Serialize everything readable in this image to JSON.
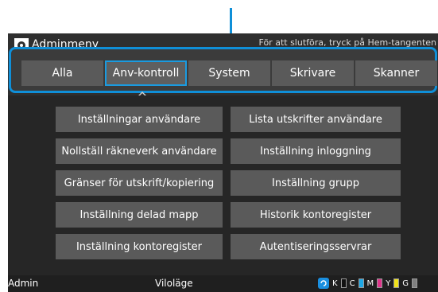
{
  "window": {
    "title": "Adminmeny",
    "hint": "För att slutföra, tryck på Hem-tangenten"
  },
  "tabs": [
    {
      "label": "Alla",
      "active": false
    },
    {
      "label": "Anv-kontroll",
      "active": true
    },
    {
      "label": "System",
      "active": false
    },
    {
      "label": "Skrivare",
      "active": false
    },
    {
      "label": "Skanner",
      "active": false
    }
  ],
  "menu": {
    "left": [
      "Inställningar användare",
      "Nollställ räkneverk användare",
      "Gränser för utskrift/kopiering",
      "Inställning delad mapp",
      "Inställning kontoregister"
    ],
    "right": [
      "Lista utskrifter användare",
      "Inställning inloggning",
      "Inställning grupp",
      "Historik kontoregister",
      "Autentiseringsservrar"
    ]
  },
  "status": {
    "user": "Admin",
    "mode": "Viloläge",
    "toners": [
      {
        "label": "K",
        "color": "#111111"
      },
      {
        "label": "C",
        "color": "#1ea8e6"
      },
      {
        "label": "M",
        "color": "#e0338a"
      },
      {
        "label": "Y",
        "color": "#f2e21a"
      },
      {
        "label": "G",
        "color": "#808080"
      }
    ]
  },
  "colors": {
    "accent": "#0f8fd8"
  }
}
